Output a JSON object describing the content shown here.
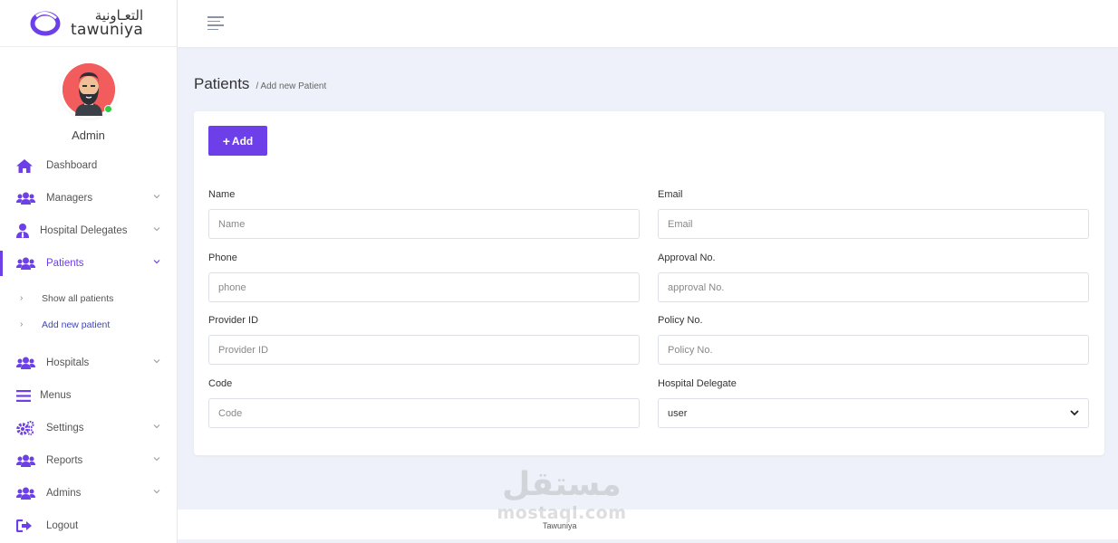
{
  "brand": {
    "name_ar": "التعـاونية",
    "name_en": "tawuniya",
    "accent": "#6c3fe8"
  },
  "profile": {
    "name": "Admin"
  },
  "sidebar": {
    "items": [
      {
        "label": "Dashboard",
        "icon": "home-icon"
      },
      {
        "label": "Managers",
        "icon": "users-icon"
      },
      {
        "label": "Hospital Delegates",
        "icon": "user-tie-icon"
      },
      {
        "label": "Patients",
        "icon": "users-icon"
      },
      {
        "label": "Hospitals",
        "icon": "users-icon"
      },
      {
        "label": "Menus",
        "icon": "menu-icon"
      },
      {
        "label": "Settings",
        "icon": "cogs-icon"
      },
      {
        "label": "Reports",
        "icon": "users-icon"
      },
      {
        "label": "Admins",
        "icon": "users-icon"
      },
      {
        "label": "Logout",
        "icon": "logout-icon"
      }
    ],
    "patients_sub": [
      {
        "label": "Show all patients"
      },
      {
        "label": "Add new patient"
      }
    ]
  },
  "page": {
    "title": "Patients",
    "breadcrumb": "/ Add new Patient"
  },
  "form": {
    "add_label": "Add",
    "name": {
      "label": "Name",
      "placeholder": "Name"
    },
    "email": {
      "label": "Email",
      "placeholder": "Email"
    },
    "phone": {
      "label": "Phone",
      "placeholder": "phone"
    },
    "approval": {
      "label": "Approval No.",
      "placeholder": "approval No."
    },
    "provider": {
      "label": "Provider ID",
      "placeholder": "Provider ID"
    },
    "policy": {
      "label": "Policy No.",
      "placeholder": "Policy No."
    },
    "code": {
      "label": "Code",
      "placeholder": "Code"
    },
    "delegate": {
      "label": "Hospital Delegate",
      "value": "user"
    }
  },
  "footer": {
    "text": "Tawuniya"
  },
  "watermark": {
    "ar": "مستقل",
    "en": "mostaql.com"
  }
}
